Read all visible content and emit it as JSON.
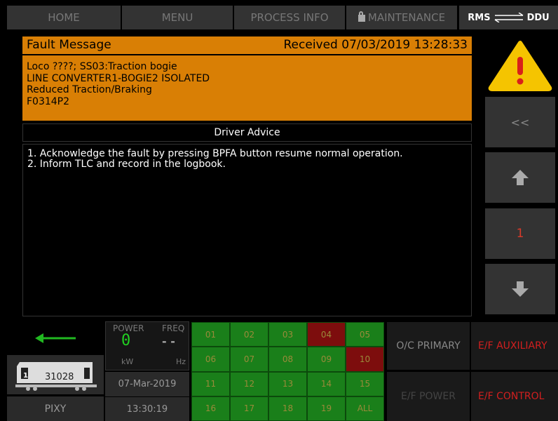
{
  "nav": {
    "home": "HOME",
    "menu": "MENU",
    "process_info": "PROCESS INFO",
    "maintenance": "MAINTENANCE",
    "rms": "RMS",
    "ddu": "DDU"
  },
  "fault": {
    "header_label": "Fault Message",
    "received": "Received 07/03/2019 13:28:33",
    "lines": [
      "Loco ????;  SS03:Traction bogie",
      "LINE CONVERTER1-BOGIE2 ISOLATED",
      "Reduced Traction/Braking",
      "F0314P2"
    ]
  },
  "advice": {
    "title": "Driver Advice",
    "lines": [
      "1. Acknowledge the fault by pressing BPFA button resume normal operation.",
      "2. Inform TLC and record in the logbook."
    ]
  },
  "side": {
    "back_label": "<<",
    "page_number": "1",
    "warning_color": "#f5c400",
    "page_color": "#d93a2a"
  },
  "bottom": {
    "power_label": "POWER",
    "freq_label": "FREQ",
    "power_value": "0",
    "freq_value": "- -",
    "power_unit": "kW",
    "freq_unit": "Hz",
    "loco_number": "31028",
    "date": "07-Mar-2019",
    "time": "13:30:19",
    "pixy": "PIXY",
    "grid": [
      {
        "label": "01",
        "state": "green"
      },
      {
        "label": "02",
        "state": "green"
      },
      {
        "label": "03",
        "state": "green"
      },
      {
        "label": "04",
        "state": "red"
      },
      {
        "label": "05",
        "state": "green"
      },
      {
        "label": "06",
        "state": "green"
      },
      {
        "label": "07",
        "state": "green"
      },
      {
        "label": "08",
        "state": "green"
      },
      {
        "label": "09",
        "state": "green"
      },
      {
        "label": "10",
        "state": "red"
      },
      {
        "label": "11",
        "state": "green"
      },
      {
        "label": "12",
        "state": "green"
      },
      {
        "label": "13",
        "state": "green"
      },
      {
        "label": "14",
        "state": "green"
      },
      {
        "label": "15",
        "state": "green"
      },
      {
        "label": "16",
        "state": "green"
      },
      {
        "label": "17",
        "state": "green"
      },
      {
        "label": "18",
        "state": "green"
      },
      {
        "label": "19",
        "state": "green"
      },
      {
        "label": "ALL",
        "state": "green"
      }
    ],
    "oc_primary": "O/C PRIMARY",
    "ef_auxiliary": "E/F AUXILIARY",
    "ef_power": "E/F POWER",
    "ef_control": "E/F CONTROL"
  }
}
